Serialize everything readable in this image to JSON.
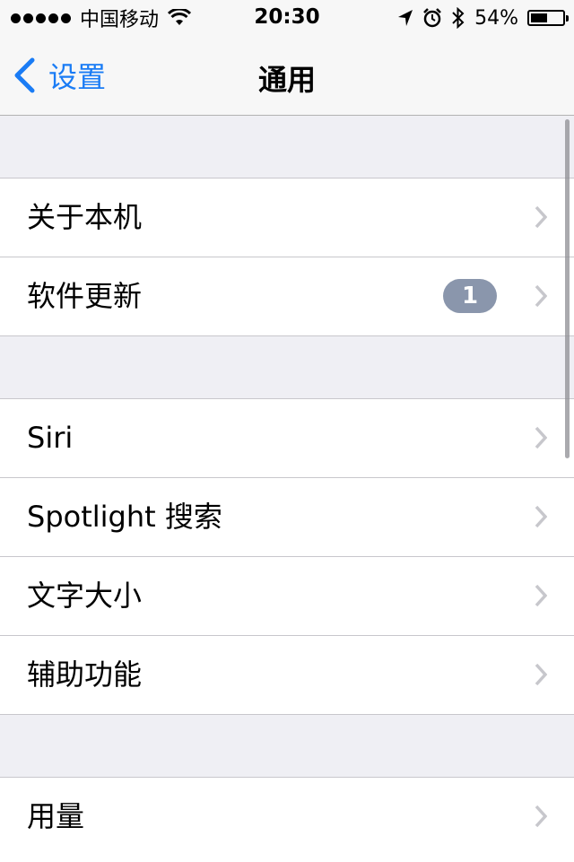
{
  "status_bar": {
    "carrier": "中国移动",
    "time": "20:30",
    "battery_percent_label": "54%",
    "battery_level": 0.54,
    "icons": [
      "signal-dots-icon",
      "wifi-icon",
      "location-arrow-icon",
      "alarm-icon",
      "bluetooth-icon",
      "battery-icon"
    ]
  },
  "nav": {
    "back_label": "设置",
    "title": "通用"
  },
  "groups": [
    {
      "items": [
        {
          "label": "关于本机"
        },
        {
          "label": "软件更新",
          "badge": "1"
        }
      ]
    },
    {
      "items": [
        {
          "label": "Siri"
        },
        {
          "label": "Spotlight 搜索"
        },
        {
          "label": "文字大小"
        },
        {
          "label": "辅助功能"
        }
      ]
    },
    {
      "items": [
        {
          "label": "用量"
        }
      ]
    }
  ],
  "colors": {
    "accent": "#1a7cf5",
    "badge": "#8a96ac",
    "background": "#efeff4"
  }
}
